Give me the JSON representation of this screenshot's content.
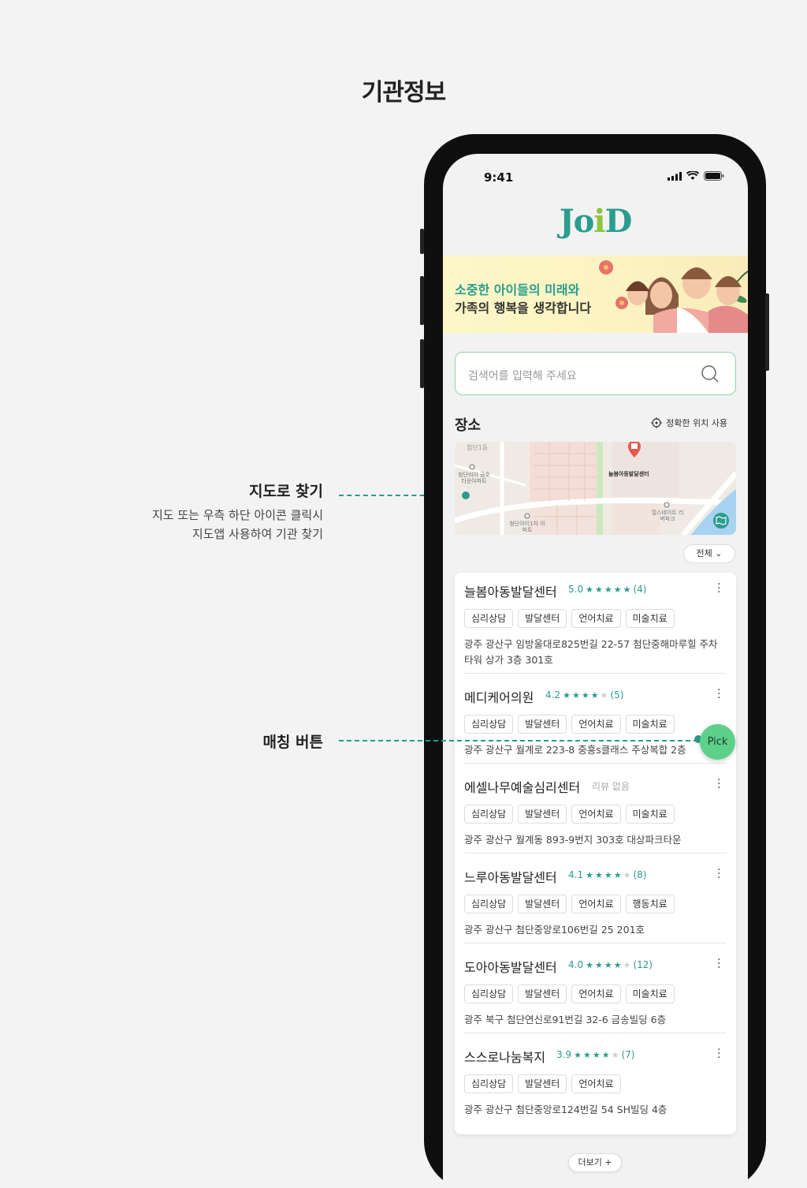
{
  "page_title": "기관정보",
  "annotations": {
    "map": {
      "title": "지도로 찾기",
      "desc_line1": "지도 또는 우측 하단 아이콘 클릭시",
      "desc_line2": "지도앱 사용하여 기관 찾기"
    },
    "matching": {
      "title": "매칭 버튼"
    }
  },
  "status_bar": {
    "time": "9:41"
  },
  "app": {
    "logo": "JoiD",
    "banner": {
      "line1": "소중한 아이들의 미래와",
      "line2": "가족의 행복을 생각합니다"
    },
    "search": {
      "placeholder": "검색어를 입력해 주세요"
    },
    "place_section": {
      "title": "장소",
      "location_button": "정확한 위치 사용"
    },
    "map": {
      "labels": [
        "첨단1동",
        "첨단비아 금호타운아파트",
        "늘봄아동발달센터",
        "첨단아이1차 아파트",
        "힐스테이트 리버파크"
      ]
    },
    "filter": "전체",
    "pick_button": "Pick",
    "more_button": "더보기 +"
  },
  "centers": [
    {
      "name": "늘봄아동발달센터",
      "score": "5.0",
      "stars": 5,
      "count": "(4)",
      "tags": [
        "심리상담",
        "발달센터",
        "언어치료",
        "미술치료"
      ],
      "address": "광주 광산구 임방울대로825번길 22-57 첨단중해마루힐 주차타워 상가 3층 301호"
    },
    {
      "name": "메디케어의원",
      "score": "4.2",
      "stars": 4,
      "count": "(5)",
      "tags": [
        "심리상담",
        "발달센터",
        "언어치료",
        "미술치료"
      ],
      "address": "광주 광산구 월계로 223-8 중흥s클래스 주상복합 2층"
    },
    {
      "name": "에셀나무예술심리센터",
      "score": "",
      "stars": 0,
      "count": "",
      "no_review": "리뷰 없음",
      "tags": [
        "심리상담",
        "발달센터",
        "언어치료",
        "미술치료"
      ],
      "address": "광주 광산구 월계동 893-9번지 303호 대상파크타운"
    },
    {
      "name": "느루아동발달센터",
      "score": "4.1",
      "stars": 4,
      "count": "(8)",
      "tags": [
        "심리상담",
        "발달센터",
        "언어치료",
        "행동치료"
      ],
      "address": "광주 광산구 첨단중앙로106번길 25 201호"
    },
    {
      "name": "도아아동발달센터",
      "score": "4.0",
      "stars": 4,
      "count": "(12)",
      "tags": [
        "심리상담",
        "발달센터",
        "언어치료",
        "미술치료"
      ],
      "address": "광주 북구 첨단연신로91번길 32-6 금송빌딩 6층"
    },
    {
      "name": "스스로나눔복지",
      "score": "3.9",
      "stars": 4,
      "count": "(7)",
      "tags": [
        "심리상담",
        "발달센터",
        "언어치료"
      ],
      "address": "광주 광산구 첨단중앙로124번길 54 SH빌딩 4층"
    }
  ],
  "colors": {
    "accent": "#2a9d8f",
    "pick": "#5fd08a",
    "search_border": "#8fd3a3"
  }
}
